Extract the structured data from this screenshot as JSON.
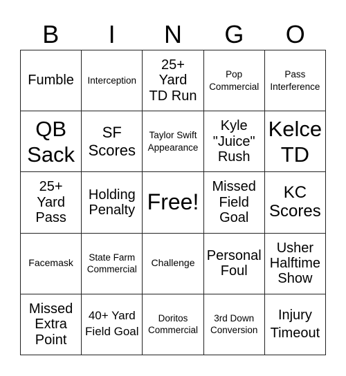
{
  "header": [
    "B",
    "I",
    "N",
    "G",
    "O"
  ],
  "cells": [
    "Fumble",
    "Interception",
    "25+ Yard TD Run",
    "Pop Commercial",
    "Pass Interference",
    "QB Sack",
    "SF Scores",
    "Taylor Swift Appearance",
    "Kyle \"Juice\" Rush",
    "Kelce TD",
    "25+ Yard Pass",
    "Holding Penalty",
    "Free!",
    "Missed Field Goal",
    "KC Scores",
    "Facemask",
    "State Farm Commercial",
    "Challenge",
    "Personal Foul",
    "Usher Halftime Show",
    "Missed Extra Point",
    "40+ Yard Field Goal",
    "Doritos Commercial",
    "3rd Down Conversion",
    "Injury Timeout"
  ]
}
